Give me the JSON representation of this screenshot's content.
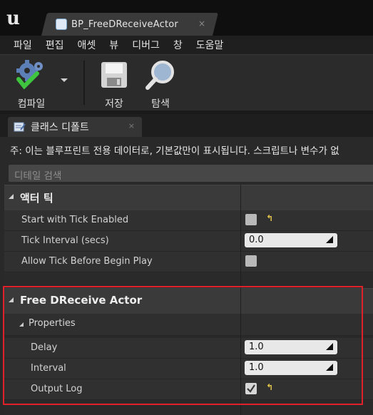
{
  "window": {
    "tab_title": "BP_FreeDReceiveActor",
    "tab_close": "×"
  },
  "menu": [
    "파일",
    "편집",
    "애셋",
    "뷰",
    "디버그",
    "창",
    "도움말"
  ],
  "toolbar": {
    "compile_label": "컴파일",
    "save_label": "저장",
    "browse_label": "탐색"
  },
  "details_panel": {
    "tab_label": "클래스 디폴트",
    "tab_close": "×",
    "note": "주: 이는 블루프린트 전용 데이터로, 기본값만이 표시됩니다. 스크립트나 변수가 없",
    "search_placeholder": "디테일 검색"
  },
  "categories": [
    {
      "title": "액터 틱",
      "rows": [
        {
          "label": "Start with Tick Enabled",
          "type": "checkbox",
          "checked": false,
          "reset_icon": "reset-arrow-icon"
        },
        {
          "label": "Tick Interval (secs)",
          "type": "number",
          "value": "0.0"
        },
        {
          "label": "Allow Tick Before Begin Play",
          "type": "checkbox",
          "checked": false
        }
      ]
    },
    {
      "title": "Free DReceive Actor",
      "subcategory": "Properties",
      "rows": [
        {
          "label": "Delay",
          "type": "number",
          "value": "1.0"
        },
        {
          "label": "Interval",
          "type": "number",
          "value": "1.0"
        },
        {
          "label": "Output Log",
          "type": "checkbox",
          "checked": true,
          "reset_icon": "reset-arrow-icon"
        }
      ]
    }
  ],
  "colors": {
    "highlight_border": "#e0202a",
    "reset_icon": "#e6c84a",
    "field_bg": "#e8e8e8"
  }
}
